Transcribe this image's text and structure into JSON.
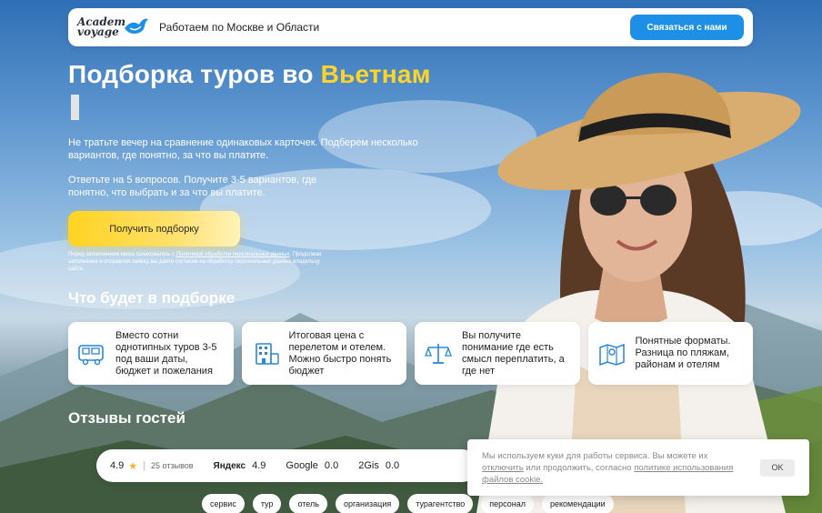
{
  "header": {
    "logo_line1": "Academ",
    "logo_line2": "voyage",
    "tagline": "Работаем по Москве и Области",
    "contact_button": "Связаться с нами"
  },
  "hero": {
    "title_main": "Подборка туров во",
    "title_accent": "Вьетнам",
    "paragraph1": "Не тратьте вечер на сравнение одинаковых карточек. Подберем несколько вариантов, где понятно, за что вы платите.",
    "paragraph2": "Ответьте на 5 вопросов. Получите 3-5 вариантов, где понятно, что выбрать и за что вы платите.",
    "cta_button": "Получить подборку",
    "legal_before": "Перед заполнением квиза ознакомьтесь с ",
    "legal_link": "Политикой обработки персональных данных",
    "legal_after": ". Продолжая заполнение и отправляя заявку, вы даете согласие на обработку персональных данных владельцу сайта."
  },
  "features": {
    "title": "Что будет в подборке",
    "cards": [
      {
        "icon": "bus-icon",
        "text": "Вместо сотни однотипных туров 3-5 под ваши даты, бюджет и пожелания"
      },
      {
        "icon": "hotel-icon",
        "text": "Итоговая цена с перелетом и отелем. Можно быстро понять бюджет"
      },
      {
        "icon": "scales-icon",
        "text": "Вы получите понимание где есть смысл переплатить, а где нет"
      },
      {
        "icon": "map-icon",
        "text": "Понятные форматы. Разница по пляжам, районам и отелям"
      }
    ]
  },
  "reviews": {
    "title": "Отзывы гостей",
    "rating": "4.9",
    "count": "25 отзывов",
    "sources": [
      {
        "name": "Яндекс",
        "value": "4.9"
      },
      {
        "name": "Google",
        "value": "0.0"
      },
      {
        "name": "2Gis",
        "value": "0.0"
      }
    ],
    "tags": [
      "сервис",
      "тур",
      "отель",
      "организация",
      "турагентство",
      "персонал",
      "рекомендации"
    ]
  },
  "cookie": {
    "text_before": "Мы используем куки для работы сервиса. Вы можете их ",
    "link_disable": "отключить",
    "text_middle": " или продолжить, согласно ",
    "link_policy": "политике использования файлов cookie.",
    "ok_button": "OK"
  },
  "colors": {
    "accent_yellow": "#ffd42a",
    "button_blue": "#1e8fe6",
    "icon_blue": "#2a86d8"
  }
}
